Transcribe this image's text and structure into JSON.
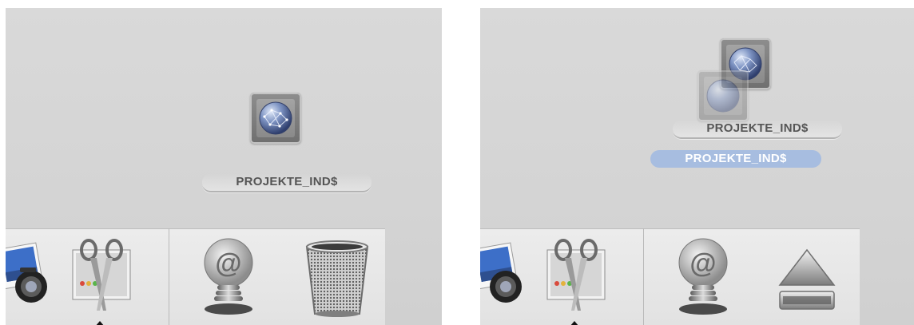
{
  "desktop": {
    "volume_label": "PROJEKTE_IND$",
    "volume_icon": "network-globe-icon"
  },
  "dock": {
    "left_section": [
      {
        "name": "iphoto-icon"
      },
      {
        "name": "screenshot-grab-icon"
      }
    ],
    "right_section_left_panel": [
      {
        "name": "mail-icon"
      },
      {
        "name": "trash-icon"
      }
    ],
    "right_section_right_panel": [
      {
        "name": "mail-icon"
      },
      {
        "name": "eject-icon"
      }
    ]
  },
  "colors": {
    "desktop_bg": "#d6d6d6",
    "selection": "#a7bde0",
    "label_text": "#555555"
  }
}
